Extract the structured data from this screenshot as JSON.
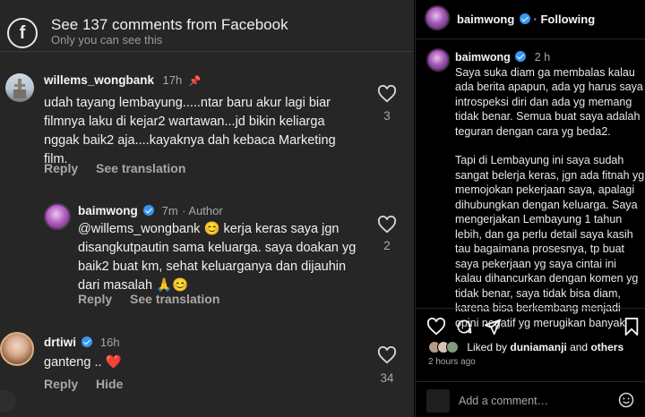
{
  "facebook_bar": {
    "title": "See 137 comments from Facebook",
    "subtitle": "Only you can see this",
    "icon": "facebook-icon"
  },
  "comments": [
    {
      "username": "willems_wongbank",
      "time": "17h",
      "text": "udah tayang lembayung.....ntar baru akur lagi biar filmnya laku di kejar2 wartawan...jd bikin keliarga nggak baik2 aja....kayaknya dah kebaca Marketing film.",
      "likes": "3",
      "reply_label": "Reply",
      "translate_label": "See translation"
    },
    {
      "username": "baimwong",
      "time": "7m",
      "author_label": "Author",
      "text": "@willems_wongbank 😊 kerja keras saya jgn disangkutpautin sama keluarga. saya doakan yg baik2 buat km, sehat keluarganya dan dijauhin dari masalah 🙏😊",
      "likes": "2",
      "reply_label": "Reply",
      "translate_label": "See translation"
    },
    {
      "username": "drtiwi",
      "time": "16h",
      "text": "ganteng .. ❤️",
      "likes": "34",
      "reply_label": "Reply",
      "hide_label": "Hide"
    }
  ],
  "post": {
    "username": "baimwong",
    "follow_label": "Following",
    "caption_time": "2 h",
    "caption_paragraphs": [
      "Saya suka diam ga membalas kalau ada berita apapun, ada yg harus saya introspeksi diri dan ada yg memang tidak benar. Semua buat saya adalah teguran dengan cara yg beda2.",
      "Tapi di Lembayung ini saya sudah sangat belerja keras, jgn ada fitnah yg memojokan pekerjaan saya, apalagi dihubungkan dengan keluarga. Saya mengerjakan Lembayung 1 tahun lebih, dan ga perlu detail saya kasih tau bagaimana prosesnya, tp buat saya pekerjaan yg saya cintai ini kalau dihancurkan dengan komen yg tidak benar, saya tidak bisa diam, karena bisa berkembang menjadi opini negatif yg merugikan banyak pihak, karena proses sebuah film berkaitan dengan banyak pihak. lain halnya dengan pemberitaan"
    ],
    "liked_prefix": "Liked by",
    "liked_user": "duniamanji",
    "liked_and": "and",
    "liked_others": "others",
    "time_ago": "2 hours ago",
    "add_comment_placeholder": "Add a comment…"
  },
  "colors": {
    "panel_bg": "#262626",
    "post_bg": "#000000",
    "verified": "#3897f0",
    "heart_red": "#ed2b3a"
  }
}
